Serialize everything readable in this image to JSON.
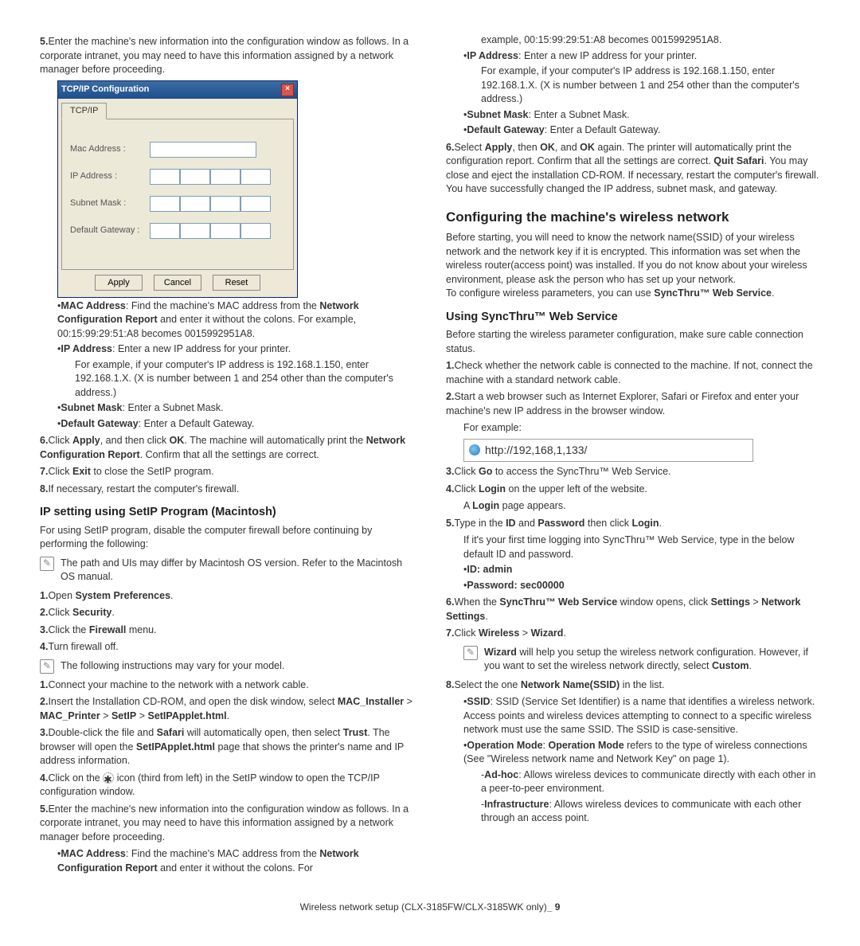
{
  "left": {
    "s5": "Enter the machine's new information into the configuration window as follows. In a corporate intranet, you may need to have this information assigned by a network manager before proceeding.",
    "dialog": {
      "title": "TCP/IP Configuration",
      "tab": "TCP/IP",
      "mac_label": "Mac Address :",
      "ip_label": "IP Address :",
      "subnet_label": "Subnet Mask :",
      "gw_label": "Default Gateway :",
      "apply": "Apply",
      "cancel": "Cancel",
      "reset": "Reset"
    },
    "b_mac": "MAC Address",
    "b_mac_t": ": Find the machine's MAC address from the ",
    "b_mac_r": "Network Configuration Report",
    "b_mac_t2": " and enter it without the colons. For example, 00:15:99:29:51:A8 becomes 0015992951A8.",
    "b_ip": "IP Address",
    "b_ip_t": ": Enter a new IP address for your printer.",
    "b_ip_eg": "For example, if your computer's IP address is 192.168.1.150, enter 192.168.1.X. (X is number between 1 and 254 other than the computer's address.)",
    "b_sm": "Subnet Mask",
    "b_sm_t": ": Enter a Subnet Mask.",
    "b_gw": "Default Gateway",
    "b_gw_t": ": Enter a Default Gateway.",
    "s6a": "Click ",
    "s6_apply": "Apply",
    "s6b": ", and then click ",
    "s6_ok": "OK",
    "s6c": ". The machine will automatically print the ",
    "s6_ncr": "Network Configuration Report",
    "s6d": ". Confirm that all the settings are correct.",
    "s7a": "Click ",
    "s7_exit": "Exit",
    "s7b": " to close the SetIP program.",
    "s8": "If necessary, restart the computer's firewall.",
    "h_mac": "IP setting using SetIP Program (Macintosh)",
    "mac_intro": "For using SetIP program, disable the computer firewall before continuing by performing the following:",
    "note1": "The path and UIs may differ by Macintosh OS version. Refer to the Macintosh OS manual.",
    "m1a": "Open ",
    "m1b": "System Preferences",
    "m2a": "Click ",
    "m2b": "Security",
    "m3a": "Click the ",
    "m3b": "Firewall",
    "m3c": " menu.",
    "m4": "Turn firewall off.",
    "note2": "The following instructions may vary for your model.",
    "c1": "Connect your machine to the network with a network cable.",
    "c2a": "Insert the Installation CD-ROM, and open the disk window, select ",
    "c2b": "MAC_Installer",
    "c2c": "MAC_Printer",
    "c2d": "SetIP",
    "c2e": "SetIPApplet.html",
    "c3a": "Double-click the file and ",
    "c3b": "Safari",
    "c3c": " will automatically open, then select ",
    "c3d": "Trust",
    "c3e": ". The browser will open the ",
    "c3f": "SetIPApplet.html",
    "c3g": " page that shows the printer's name and IP address information.",
    "c4a": "Click on the ",
    "c4b": " icon (third from left) in the SetIP window to open the TCP/IP configuration window.",
    "c5": "Enter the machine's new information into the configuration window as follows. In a corporate intranet, you may need to have this information assigned by a network manager before proceeding.",
    "c5_mac": "MAC Address",
    "c5_mac_t": ": Find the machine's MAC address from the ",
    "c5_mac_r": "Network Configuration Report",
    "c5_mac_t2": " and enter it without the colons. For"
  },
  "right": {
    "cont1": "example, 00:15:99:29:51:A8 becomes 0015992951A8.",
    "b_ip": "IP Address",
    "b_ip_t": ": Enter a new IP address for your printer.",
    "b_ip_eg": "For example, if your computer's IP address is 192.168.1.150, enter 192.168.1.X. (X is number between 1 and 254 other than the computer's address.)",
    "b_sm": "Subnet Mask",
    "b_sm_t": ": Enter a Subnet Mask.",
    "b_gw": "Default Gateway",
    "b_gw_t": ": Enter a Default Gateway.",
    "s6a": "Select ",
    "s6b": "Apply",
    "s6c": ", then ",
    "s6d": "OK",
    "s6e": ", and ",
    "s6f": "OK",
    "s6g": " again. The printer will automatically print the configuration report. Confirm that all the settings are correct. ",
    "s6h": "Quit Safari",
    "s6i": ". You may close and eject the installation CD-ROM. If necessary, restart the computer's firewall. You have successfully changed the IP address, subnet mask, and gateway.",
    "h_cfg": "Configuring the machine's wireless network",
    "cfg_p": "Before starting, you will need to know the network name(SSID) of your wireless network and the network key if it is encrypted. This information was set when the wireless router(access point) was installed. If you do not know about your wireless environment, please ask the person who has set up your network.",
    "cfg_p2a": "To configure wireless parameters, you can use ",
    "cfg_p2b": "SyncThru™ Web Service",
    "h_sync": "Using SyncThru™ Web Service",
    "sync_p": "Before starting the wireless parameter configuration, make sure cable connection status.",
    "w1": "Check whether the network cable is connected to the machine. If not, connect the machine with a standard network cable.",
    "w2": "Start a web browser such as Internet Explorer, Safari or Firefox and enter your machine's new IP address in the browser window.",
    "w2_eg": "For example:",
    "url": "http://192,168,1,133/",
    "w3a": "Click ",
    "w3b": "Go",
    "w3c": " to access the SyncThru™ Web Service.",
    "w4a": "Click ",
    "w4b": "Login",
    "w4c": " on the upper left of the website.",
    "w4_sub": "A ",
    "w4_sub_b": "Login",
    "w4_sub2": " page appears.",
    "w5a": "Type in the ",
    "w5b": "ID",
    "w5c": " and ",
    "w5d": "Password",
    "w5e": " then click ",
    "w5f": "Login",
    "w5_note": "If it's your first time logging into SyncThru™ Web Service, type in the below default ID and password.",
    "id_lbl": "ID:  admin",
    "pw_lbl": "Password:  sec00000",
    "w6a": "When the ",
    "w6b": "SyncThru™ Web Service",
    "w6c": " window opens, click ",
    "w6d": "Settings",
    "w6e": "Network Settings",
    "w7a": "Click ",
    "w7b": "Wireless",
    "w7c": "Wizard",
    "note3a": "Wizard",
    "note3b": " will help you setup the wireless network configuration. However, if you want to set the wireless network directly, select ",
    "note3c": "Custom",
    "w8a": "Select the one ",
    "w8b": "Network Name(SSID)",
    "w8c": " in the list.",
    "ssid_b": "SSID",
    "ssid_t": ": SSID (Service Set Identifier) is a name that identifies a wireless network. Access points and wireless devices attempting to connect to a specific wireless network must use the same SSID. The SSID is case-sensitive.",
    "om_b": "Operation Mode",
    "om_b2": "Operation Mode",
    "om_t": " refers to the type of wireless connections (See \"Wireless network name and Network Key\" on page 1).",
    "adhoc_b": "Ad-hoc",
    "adhoc_t": ": Allows wireless devices to communicate directly with each other in a peer-to-peer environment.",
    "infra_b": "Infrastructure",
    "infra_t": ": Allows wireless devices to communicate with each other through an access point."
  },
  "footer": {
    "text": "Wireless network setup (CLX-3185FW/CLX-3185WK only)",
    "page": "9"
  }
}
